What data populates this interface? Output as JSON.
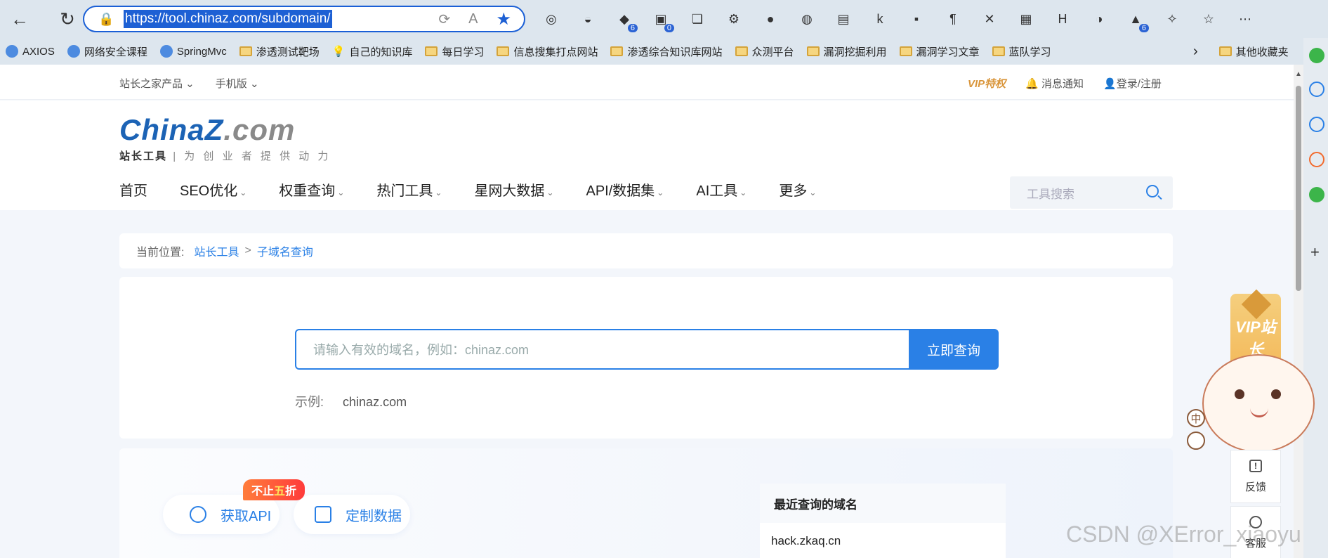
{
  "browser": {
    "url": "https://tool.chinaz.com/subdomain/",
    "back_icon": "←",
    "refresh_icon": "↻",
    "more_icon": "⋯",
    "extension_badges": [
      "6",
      "0",
      "6"
    ]
  },
  "bookmarks": [
    {
      "label": "AXIOS",
      "type": "site"
    },
    {
      "label": "网络安全课程",
      "type": "site"
    },
    {
      "label": "SpringMvc",
      "type": "site"
    },
    {
      "label": "渗透测试靶场",
      "type": "folder"
    },
    {
      "label": "自己的知识库",
      "type": "bulb"
    },
    {
      "label": "每日学习",
      "type": "folder"
    },
    {
      "label": "信息搜集打点网站",
      "type": "folder"
    },
    {
      "label": "渗透综合知识库网站",
      "type": "folder"
    },
    {
      "label": "众测平台",
      "type": "folder"
    },
    {
      "label": "漏洞挖掘利用",
      "type": "folder"
    },
    {
      "label": "漏洞学习文章",
      "type": "folder"
    },
    {
      "label": "蓝队学习",
      "type": "folder"
    }
  ],
  "bookmarks_other": "其他收藏夹",
  "topline": {
    "left": [
      "站长之家产品",
      "手机版"
    ],
    "vip": "VIP特权",
    "notify": "消息通知",
    "login": "登录/注册"
  },
  "logo": {
    "brand_main": "ChinaZ",
    "brand_suffix": ".com",
    "slogan_bold": "站长工具",
    "slogan": "| 为 创 业 者 提 供 动 力"
  },
  "nav": [
    "首页",
    "SEO优化",
    "权重查询",
    "热门工具",
    "星网大数据",
    "API/数据集",
    "AI工具",
    "更多"
  ],
  "tool_search_placeholder": "工具搜索",
  "breadcrumb": {
    "prefix": "当前位置:",
    "home": "站长工具",
    "sep": ">",
    "current": "子域名查询"
  },
  "search": {
    "placeholder": "请输入有效的域名，例如：chinaz.com",
    "button": "立即查询",
    "example_label": "示例:",
    "example_value": "chinaz.com"
  },
  "promo": {
    "discount_pre": "不止",
    "discount_num": "五",
    "discount_post": "折",
    "api_button": "获取API",
    "custom_button": "定制数据"
  },
  "recent": {
    "title": "最近查询的域名",
    "items": [
      "hack.zkaq.cn"
    ]
  },
  "side": {
    "vip_label": "VIP站长",
    "lang": "中",
    "feedback": "反馈",
    "service": "客服"
  },
  "watermark": "CSDN @XError_xiaoyu",
  "colors": {
    "accent": "#2a80e6",
    "brand": "#1c63b5",
    "vip": "#d9953a"
  }
}
